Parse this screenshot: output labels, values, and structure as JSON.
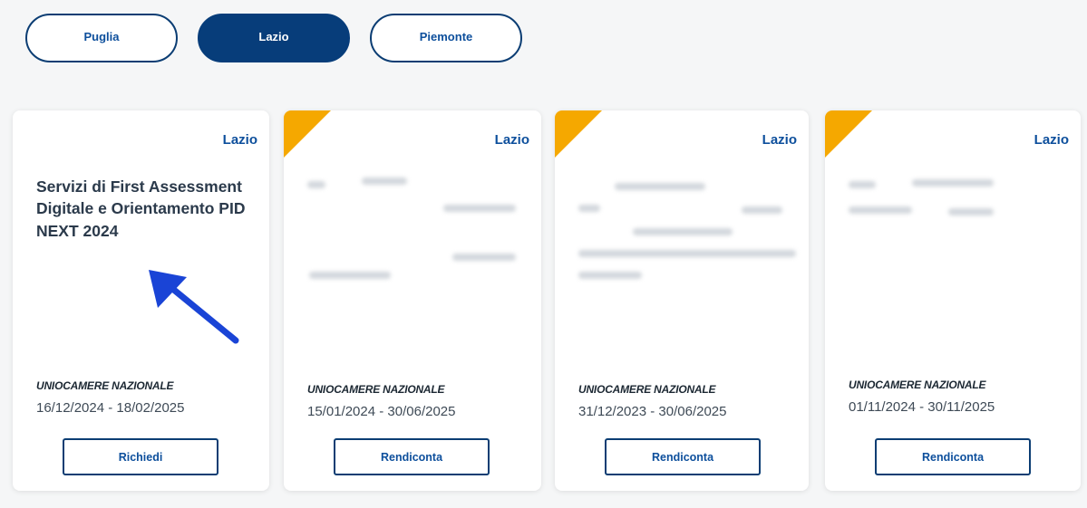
{
  "regions": [
    {
      "label": "Puglia",
      "active": false
    },
    {
      "label": "Lazio",
      "active": true
    },
    {
      "label": "Piemonte",
      "active": false
    }
  ],
  "cards": [
    {
      "tag": "Lazio",
      "title": "Servizi di First Assessment Digitale e Orientamento PID NEXT 2024",
      "title_redacted": false,
      "ribbon": false,
      "org": "UNIOCAMERE NAZIONALE",
      "dates": "16/12/2024 - 18/02/2025",
      "action": "Richiedi"
    },
    {
      "tag": "Lazio",
      "title_redacted": true,
      "ribbon": true,
      "org": "UNIOCAMERE NAZIONALE",
      "dates": "15/01/2024 - 30/06/2025",
      "action": "Rendiconta"
    },
    {
      "tag": "Lazio",
      "title_redacted": true,
      "ribbon": true,
      "org": "UNIOCAMERE NAZIONALE",
      "dates": "31/12/2023 - 30/06/2025",
      "action": "Rendiconta"
    },
    {
      "tag": "Lazio",
      "title_redacted": true,
      "ribbon": true,
      "org": "UNIOCAMERE NAZIONALE",
      "dates": "01/11/2024 - 30/11/2025",
      "action": "Rendiconta"
    }
  ],
  "colors": {
    "primary": "#073d7a",
    "link": "#0d4f9c",
    "ribbon": "#f5a800",
    "annotation_arrow": "#1a44d6"
  }
}
